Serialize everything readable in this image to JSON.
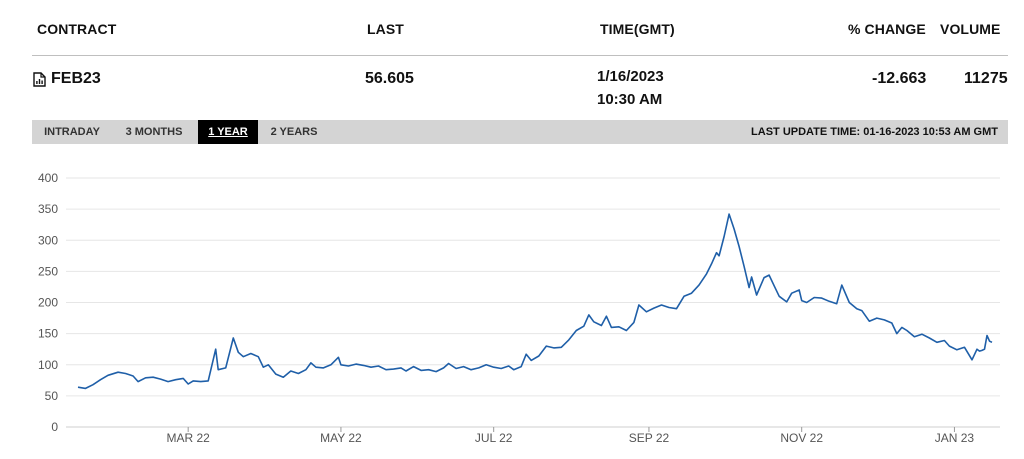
{
  "table": {
    "headers": {
      "contract": "CONTRACT",
      "last": "LAST",
      "time": "TIME(GMT)",
      "change": "% CHANGE",
      "volume": "VOLUME"
    },
    "row": {
      "contract": "FEB23",
      "contract_icon": "document-chart-icon",
      "last": "56.605",
      "date": "1/16/2023",
      "time": "10:30 AM",
      "change": "-12.663",
      "volume": "11275"
    }
  },
  "tabs": {
    "items": [
      "INTRADAY",
      "3 MONTHS",
      "1 YEAR",
      "2 YEARS"
    ],
    "active": "1 YEAR",
    "last_update": "LAST UPDATE TIME: 01-16-2023 10:53 AM GMT"
  },
  "colors": {
    "line": "#1f5fa8",
    "grid": "#e6e6e6",
    "tabbar": "#d4d4d4",
    "active_tab": "#000000"
  },
  "chart_data": {
    "type": "line",
    "title": "",
    "xlabel": "",
    "ylabel": "",
    "ylim": [
      0,
      400
    ],
    "yticks": [
      0,
      50,
      100,
      150,
      200,
      250,
      300,
      350,
      400
    ],
    "xlim": [
      "2022-01-16",
      "2023-01-16"
    ],
    "xticks": [
      {
        "date": "2022-03-01",
        "label": "MAR 22"
      },
      {
        "date": "2022-05-01",
        "label": "MAY 22"
      },
      {
        "date": "2022-07-01",
        "label": "JUL 22"
      },
      {
        "date": "2022-09-01",
        "label": "SEP 22"
      },
      {
        "date": "2022-11-01",
        "label": "NOV 22"
      },
      {
        "date": "2023-01-01",
        "label": "JAN 23"
      }
    ],
    "grid": true,
    "series": [
      {
        "color": "#1f5fa8",
        "points": [
          [
            "2022-01-16",
            64
          ],
          [
            "2022-01-19",
            62
          ],
          [
            "2022-01-22",
            68
          ],
          [
            "2022-01-25",
            76
          ],
          [
            "2022-01-28",
            83
          ],
          [
            "2022-02-01",
            88
          ],
          [
            "2022-02-04",
            86
          ],
          [
            "2022-02-07",
            82
          ],
          [
            "2022-02-09",
            73
          ],
          [
            "2022-02-12",
            79
          ],
          [
            "2022-02-15",
            80
          ],
          [
            "2022-02-18",
            77
          ],
          [
            "2022-02-21",
            73
          ],
          [
            "2022-02-24",
            76
          ],
          [
            "2022-02-27",
            78
          ],
          [
            "2022-03-01",
            69
          ],
          [
            "2022-03-03",
            74
          ],
          [
            "2022-03-06",
            73
          ],
          [
            "2022-03-09",
            74
          ],
          [
            "2022-03-12",
            125
          ],
          [
            "2022-03-13",
            92
          ],
          [
            "2022-03-16",
            95
          ],
          [
            "2022-03-19",
            143
          ],
          [
            "2022-03-21",
            120
          ],
          [
            "2022-03-23",
            113
          ],
          [
            "2022-03-26",
            118
          ],
          [
            "2022-03-29",
            113
          ],
          [
            "2022-03-31",
            96
          ],
          [
            "2022-04-02",
            100
          ],
          [
            "2022-04-05",
            85
          ],
          [
            "2022-04-08",
            80
          ],
          [
            "2022-04-11",
            90
          ],
          [
            "2022-04-14",
            86
          ],
          [
            "2022-04-17",
            92
          ],
          [
            "2022-04-19",
            103
          ],
          [
            "2022-04-21",
            96
          ],
          [
            "2022-04-24",
            95
          ],
          [
            "2022-04-27",
            100
          ],
          [
            "2022-04-30",
            112
          ],
          [
            "2022-05-01",
            100
          ],
          [
            "2022-05-04",
            98
          ],
          [
            "2022-05-07",
            101
          ],
          [
            "2022-05-10",
            99
          ],
          [
            "2022-05-13",
            96
          ],
          [
            "2022-05-16",
            98
          ],
          [
            "2022-05-19",
            92
          ],
          [
            "2022-05-22",
            93
          ],
          [
            "2022-05-25",
            95
          ],
          [
            "2022-05-27",
            90
          ],
          [
            "2022-05-30",
            97
          ],
          [
            "2022-06-02",
            91
          ],
          [
            "2022-06-05",
            92
          ],
          [
            "2022-06-08",
            89
          ],
          [
            "2022-06-11",
            95
          ],
          [
            "2022-06-13",
            102
          ],
          [
            "2022-06-16",
            94
          ],
          [
            "2022-06-19",
            97
          ],
          [
            "2022-06-22",
            92
          ],
          [
            "2022-06-25",
            95
          ],
          [
            "2022-06-28",
            100
          ],
          [
            "2022-07-01",
            96
          ],
          [
            "2022-07-04",
            94
          ],
          [
            "2022-07-07",
            98
          ],
          [
            "2022-07-09",
            92
          ],
          [
            "2022-07-12",
            97
          ],
          [
            "2022-07-14",
            117
          ],
          [
            "2022-07-16",
            107
          ],
          [
            "2022-07-19",
            114
          ],
          [
            "2022-07-22",
            130
          ],
          [
            "2022-07-25",
            127
          ],
          [
            "2022-07-28",
            128
          ],
          [
            "2022-07-31",
            140
          ],
          [
            "2022-08-03",
            155
          ],
          [
            "2022-08-06",
            162
          ],
          [
            "2022-08-08",
            180
          ],
          [
            "2022-08-10",
            169
          ],
          [
            "2022-08-13",
            163
          ],
          [
            "2022-08-15",
            178
          ],
          [
            "2022-08-17",
            160
          ],
          [
            "2022-08-20",
            161
          ],
          [
            "2022-08-23",
            155
          ],
          [
            "2022-08-26",
            168
          ],
          [
            "2022-08-28",
            196
          ],
          [
            "2022-08-31",
            185
          ],
          [
            "2022-09-03",
            191
          ],
          [
            "2022-09-06",
            196
          ],
          [
            "2022-09-09",
            192
          ],
          [
            "2022-09-12",
            190
          ],
          [
            "2022-09-15",
            210
          ],
          [
            "2022-09-18",
            215
          ],
          [
            "2022-09-21",
            228
          ],
          [
            "2022-09-24",
            246
          ],
          [
            "2022-09-26",
            262
          ],
          [
            "2022-09-28",
            280
          ],
          [
            "2022-09-29",
            275
          ],
          [
            "2022-10-01",
            306
          ],
          [
            "2022-10-03",
            342
          ],
          [
            "2022-10-05",
            318
          ],
          [
            "2022-10-07",
            290
          ],
          [
            "2022-10-09",
            258
          ],
          [
            "2022-10-11",
            224
          ],
          [
            "2022-10-12",
            241
          ],
          [
            "2022-10-14",
            212
          ],
          [
            "2022-10-17",
            240
          ],
          [
            "2022-10-19",
            244
          ],
          [
            "2022-10-21",
            227
          ],
          [
            "2022-10-23",
            210
          ],
          [
            "2022-10-26",
            201
          ],
          [
            "2022-10-28",
            215
          ],
          [
            "2022-10-31",
            220
          ],
          [
            "2022-11-01",
            203
          ],
          [
            "2022-11-03",
            200
          ],
          [
            "2022-11-06",
            208
          ],
          [
            "2022-11-09",
            207
          ],
          [
            "2022-11-12",
            202
          ],
          [
            "2022-11-15",
            198
          ],
          [
            "2022-11-17",
            228
          ],
          [
            "2022-11-20",
            200
          ],
          [
            "2022-11-23",
            190
          ],
          [
            "2022-11-25",
            187
          ],
          [
            "2022-11-28",
            170
          ],
          [
            "2022-12-01",
            175
          ],
          [
            "2022-12-04",
            172
          ],
          [
            "2022-12-07",
            167
          ],
          [
            "2022-12-09",
            150
          ],
          [
            "2022-12-11",
            160
          ],
          [
            "2022-12-13",
            155
          ],
          [
            "2022-12-16",
            145
          ],
          [
            "2022-12-19",
            149
          ],
          [
            "2022-12-22",
            143
          ],
          [
            "2022-12-25",
            136
          ],
          [
            "2022-12-28",
            139
          ],
          [
            "2022-12-30",
            130
          ],
          [
            "2023-01-02",
            124
          ],
          [
            "2023-01-05",
            128
          ],
          [
            "2023-01-08",
            108
          ],
          [
            "2023-01-10",
            125
          ],
          [
            "2023-01-11",
            122
          ],
          [
            "2023-01-12",
            123
          ],
          [
            "2023-01-13",
            125
          ],
          [
            "2023-01-14",
            147
          ],
          [
            "2023-01-15",
            138
          ],
          [
            "2023-01-16",
            136
          ]
        ]
      }
    ]
  }
}
